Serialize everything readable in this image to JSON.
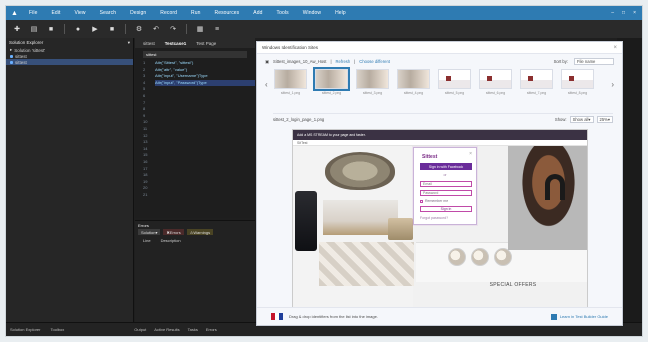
{
  "menubar": {
    "items": [
      "File",
      "Edit",
      "View",
      "Search",
      "Design",
      "Record",
      "Run",
      "Resources",
      "Add",
      "Tools",
      "Window",
      "Help"
    ]
  },
  "explorer": {
    "title": "Solution Explorer",
    "tree": [
      "Solution 'sittest'",
      "sittest",
      "sittest"
    ]
  },
  "editor": {
    "tabs": [
      "sittest",
      "Testcase1",
      "Test Page"
    ],
    "code_header": "sittest",
    "lines": [
      "",
      "Attr(\"Sittest\", \"sittest\")",
      "",
      "Attr(\"attr\", \"value\")",
      "Attr(\"input\", \"Username\")Type",
      "",
      "Attr(\"input\", \"Password\")Type",
      "",
      "",
      "",
      "",
      "",
      "",
      "",
      "",
      "",
      "",
      "",
      "",
      "",
      ""
    ],
    "line_numbers": [
      "1",
      "2",
      "3",
      "4",
      "5",
      "6",
      "7",
      "8",
      "9",
      "10",
      "11",
      "12",
      "13",
      "14",
      "15",
      "16",
      "17",
      "18",
      "19",
      "20",
      "21"
    ]
  },
  "errors": {
    "title": "Errors",
    "solution_label": "Solution",
    "error_label": "Errors",
    "warning_label": "Warnings",
    "col_line": "Line",
    "col_desc": "Description"
  },
  "statusbar": {
    "left": [
      "Solution Explorer",
      "Toolbox"
    ],
    "mid": [
      "Output",
      "Active Results",
      "Tasks",
      "Errors"
    ]
  },
  "modal": {
    "title": "Windows Identification Sites",
    "path": "Sittest_images_10_Aw_Host",
    "refresh": "Refresh",
    "change_different": "Choose different",
    "sort_label": "Sort by:",
    "sort_value": "File name",
    "thumbnails": [
      {
        "label": "sittest_1.png"
      },
      {
        "label": "sittest_2.png"
      },
      {
        "label": "sittest_3.png"
      },
      {
        "label": "sittest_4.png"
      },
      {
        "label": "sittest_5.png"
      },
      {
        "label": "sittest_6.png"
      },
      {
        "label": "sittest_7.png"
      },
      {
        "label": "sittest_8.png"
      }
    ],
    "detail_filename": "sittest_2_login_page_1.png",
    "show_label": "Show:",
    "show_value": "Show all",
    "zoom_value": "25%",
    "browser_bar": "Add a MS STREAM to your page and faster.",
    "site_bar": "SitTest",
    "signin": {
      "logo": "Sittest",
      "facebook": "Sign in with Facebook",
      "or": "or",
      "email": "Email",
      "password": "Password",
      "remember": "Remember me",
      "submit": "Sign in",
      "foot": "Forgot password?"
    },
    "preview_heading": "SPECIAL OFFERS",
    "foot_left": "Drag & drop identifiers from the list into the image.",
    "foot_right": "Learn in Test Builder Guide"
  }
}
